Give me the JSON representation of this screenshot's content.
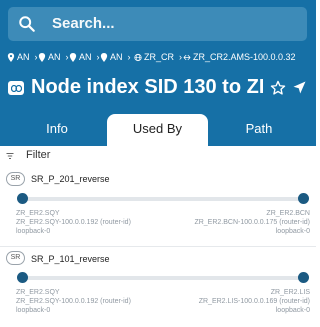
{
  "search": {
    "placeholder": "Search..."
  },
  "breadcrumb": {
    "items": [
      {
        "label": "AN",
        "icon": "location-pin-icon"
      },
      {
        "label": "AN",
        "icon": "location-pin-icon"
      },
      {
        "label": "AN",
        "icon": "location-pin-icon"
      },
      {
        "label": "AN",
        "icon": "location-pin-icon"
      },
      {
        "label": "ZR_CR",
        "icon": "globe-icon"
      },
      {
        "label": "ZR_CR2.AMS-100.0.0.32",
        "icon": "link-arrows-icon"
      }
    ]
  },
  "title": {
    "text": "Node index SID 130 to ZR_..."
  },
  "tabs": [
    {
      "label": "Info",
      "active": false
    },
    {
      "label": "Used By",
      "active": true
    },
    {
      "label": "Path",
      "active": false
    }
  ],
  "filter": {
    "label": "Filter"
  },
  "paths": [
    {
      "badge": "SR",
      "name": "SR_P_201_reverse",
      "left": {
        "name": "ZR_ER2.SQY",
        "id": "ZR_ER2.SQY-100.0.0.192 (router-id)",
        "iface": "loopback-0"
      },
      "right": {
        "name": "ZR_ER2.BCN",
        "id": "ZR_ER2.BCN-100.0.0.175 (router-id)",
        "iface": "loopback-0"
      }
    },
    {
      "badge": "SR",
      "name": "SR_P_101_reverse",
      "left": {
        "name": "ZR_ER2.SQY",
        "id": "ZR_ER2.SQY-100.0.0.192 (router-id)",
        "iface": "loopback-0"
      },
      "right": {
        "name": "ZR_ER2.LIS",
        "id": "ZR_ER2.LIS-100.0.0.169 (router-id)",
        "iface": "loopback-0"
      }
    }
  ],
  "colors": {
    "header": "#1670a6",
    "search_bg": "#3d8bb8",
    "node": "#1b5a82"
  }
}
